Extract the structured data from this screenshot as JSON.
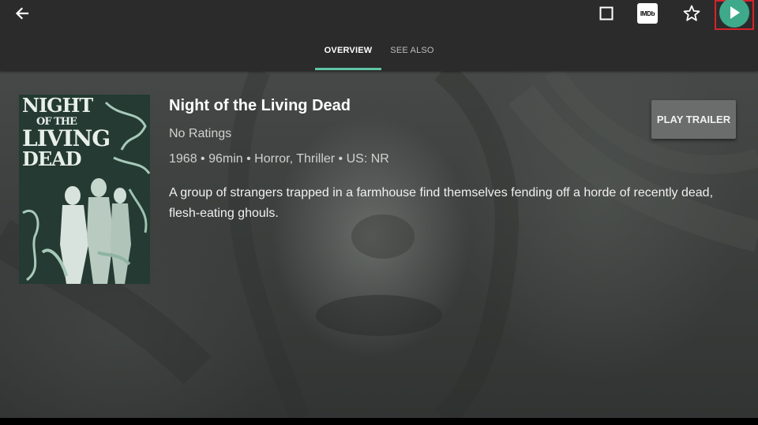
{
  "topbar": {
    "back_icon": "arrow-left-icon",
    "select_icon": "square-icon",
    "imdb_label": "IMDb",
    "favorite_icon": "star-outline-icon",
    "play_icon": "play-icon",
    "play_accent": "#3fa98b",
    "highlight_color": "#d6232a"
  },
  "tabs": [
    {
      "label": "OVERVIEW",
      "active": true
    },
    {
      "label": "SEE ALSO",
      "active": false
    }
  ],
  "tab_indicator_color": "#5fc5a6",
  "movie": {
    "poster_title_lines": [
      "NIGHT",
      "OF THE",
      "LIVING",
      "DEAD"
    ],
    "title": "Night of the Living Dead",
    "ratings": "No Ratings",
    "meta": "1968 • 96min • Horror, Thriller • US: NR",
    "overview": "A group of strangers trapped in a farmhouse find themselves fending off a horde of recently dead, flesh-eating ghouls."
  },
  "actions": {
    "play_trailer_label": "PLAY TRAILER"
  }
}
